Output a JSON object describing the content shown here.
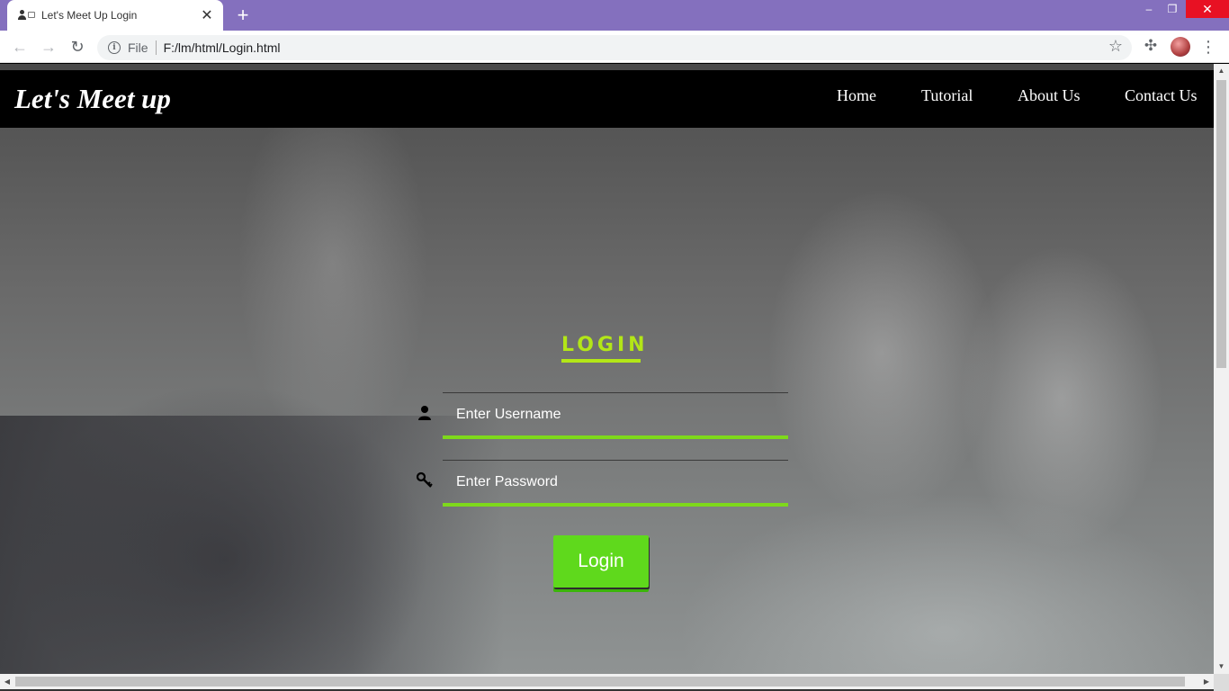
{
  "browser": {
    "tab_title": "Let's Meet Up Login",
    "tab_close": "✕",
    "new_tab": "+",
    "url_scheme": "File",
    "url": "F:/lm/html/Login.html",
    "window_controls": {
      "minimize": "–",
      "maximize": "❐",
      "close": "✕"
    },
    "nav": {
      "back": "←",
      "forward": "→",
      "reload": "↻"
    },
    "star": "☆",
    "extensions": "✣",
    "menu": "⋮"
  },
  "site": {
    "brand": "Let's Meet up",
    "nav": [
      "Home",
      "Tutorial",
      "About Us",
      "Contact Us"
    ]
  },
  "login": {
    "title": "LOGIN",
    "username_placeholder": "Enter Username",
    "password_placeholder": "Enter Password",
    "button": "Login"
  },
  "colors": {
    "accent": "#b3e617",
    "button": "#5fd91c",
    "field_underline": "#7ed91b",
    "tab_bar": "#8470be"
  },
  "icons": [
    "user-icon",
    "key-icon",
    "info-icon",
    "star-icon",
    "puzzle-icon",
    "menu-icon"
  ]
}
